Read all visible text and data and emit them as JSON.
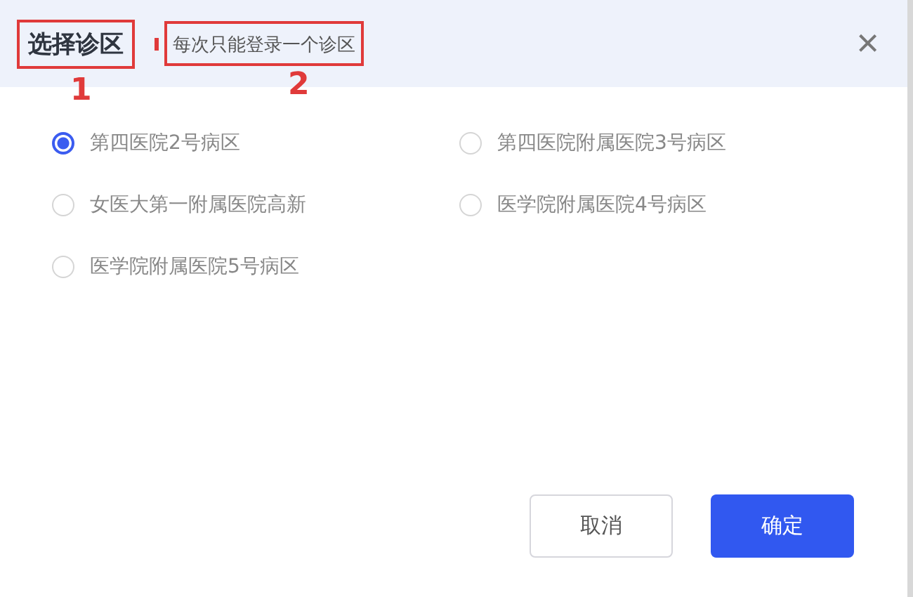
{
  "dialog": {
    "title": "选择诊区",
    "hint": "每次只能登录一个诊区",
    "close": "×"
  },
  "annotations": [
    {
      "label": "1"
    },
    {
      "label": "2"
    }
  ],
  "options": [
    {
      "label": "第四医院2号病区",
      "selected": true
    },
    {
      "label": "第四医院附属医院3号病区",
      "selected": false
    },
    {
      "label": "女医大第一附属医院高新",
      "selected": false
    },
    {
      "label": "医学院附属医院4号病区",
      "selected": false
    },
    {
      "label": "医学院附属医院5号病区",
      "selected": false
    }
  ],
  "buttons": [
    {
      "label": "取消",
      "kind": "secondary"
    },
    {
      "label": "确定",
      "kind": "primary"
    }
  ]
}
